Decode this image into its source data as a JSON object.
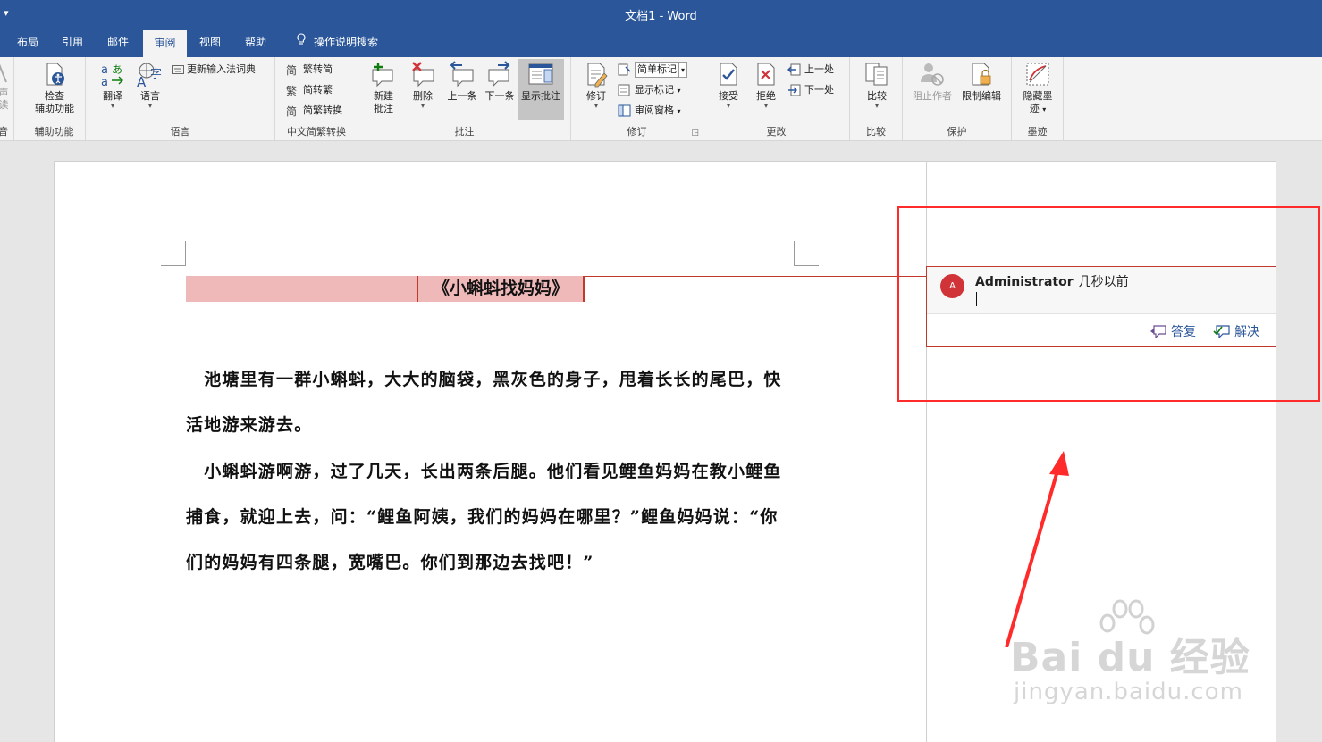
{
  "titlebar": {
    "qa": "▾",
    "title": "文档1  -  Word"
  },
  "tabs": [
    {
      "label": "布局"
    },
    {
      "label": "引用"
    },
    {
      "label": "邮件"
    },
    {
      "label": "审阅",
      "active": true
    },
    {
      "label": "视图"
    },
    {
      "label": "帮助"
    },
    {
      "label": "操作说明搜索",
      "icon": "lightbulb-icon"
    }
  ],
  "ribbon": {
    "speech": {
      "line1": "声",
      "line2": "读",
      "label": "音"
    },
    "accessibility": {
      "btn_line1": "检查",
      "btn_line2": "辅助功能",
      "label": "辅助功能"
    },
    "language": {
      "translate": "翻译",
      "language": "语言",
      "update_ime": "更新输入法词典",
      "label": "语言"
    },
    "chinese": {
      "t2s": "繁转简",
      "s2t": "简转繁",
      "convert": "简繁转换",
      "label": "中文简繁转换"
    },
    "comments": {
      "new_line1": "新建",
      "new_line2": "批注",
      "delete": "删除",
      "prev": "上一条",
      "next": "下一条",
      "show": "显示批注",
      "label": "批注"
    },
    "tracking": {
      "track": "修订",
      "markup_dropdown": "简单标记",
      "show_markup": "显示标记",
      "review_pane": "审阅窗格",
      "label": "修订"
    },
    "changes": {
      "accept": "接受",
      "reject": "拒绝",
      "prev": "上一处",
      "next": "下一处",
      "label": "更改"
    },
    "compare": {
      "compare": "比较",
      "label": "比较"
    },
    "protect": {
      "block": "阻止作者",
      "restrict": "限制编辑",
      "label": "保护"
    },
    "ink": {
      "hide_line1": "隐藏墨",
      "hide_line2": "迹",
      "label": "墨迹"
    }
  },
  "document": {
    "title": "《小蝌蚪找妈妈》",
    "paragraphs": [
      "　池塘里有一群小蝌蚪，大大的脑袋，黑灰色的身子，甩着长长的尾巴，快活地游来游去。",
      "　小蝌蚪游啊游，过了几天，长出两条后腿。他们看见鲤鱼妈妈在教小鲤鱼捕食，就迎上去，问：“鲤鱼阿姨，我们的妈妈在哪里？”鲤鱼妈妈说：“你们的妈妈有四条腿，宽嘴巴。你们到那边去找吧！”"
    ]
  },
  "comment": {
    "avatar": "A",
    "author": "Administrator",
    "time": "几秒以前",
    "reply": "答复",
    "resolve": "解决"
  },
  "watermark": {
    "brand": "Bai  du 经验",
    "url": "jingyan.baidu.com"
  },
  "colors": {
    "brand": "#2b579a",
    "highlight": "#f0b9b9",
    "comment_border": "#c0392b",
    "annotation": "#ff2a2a"
  }
}
